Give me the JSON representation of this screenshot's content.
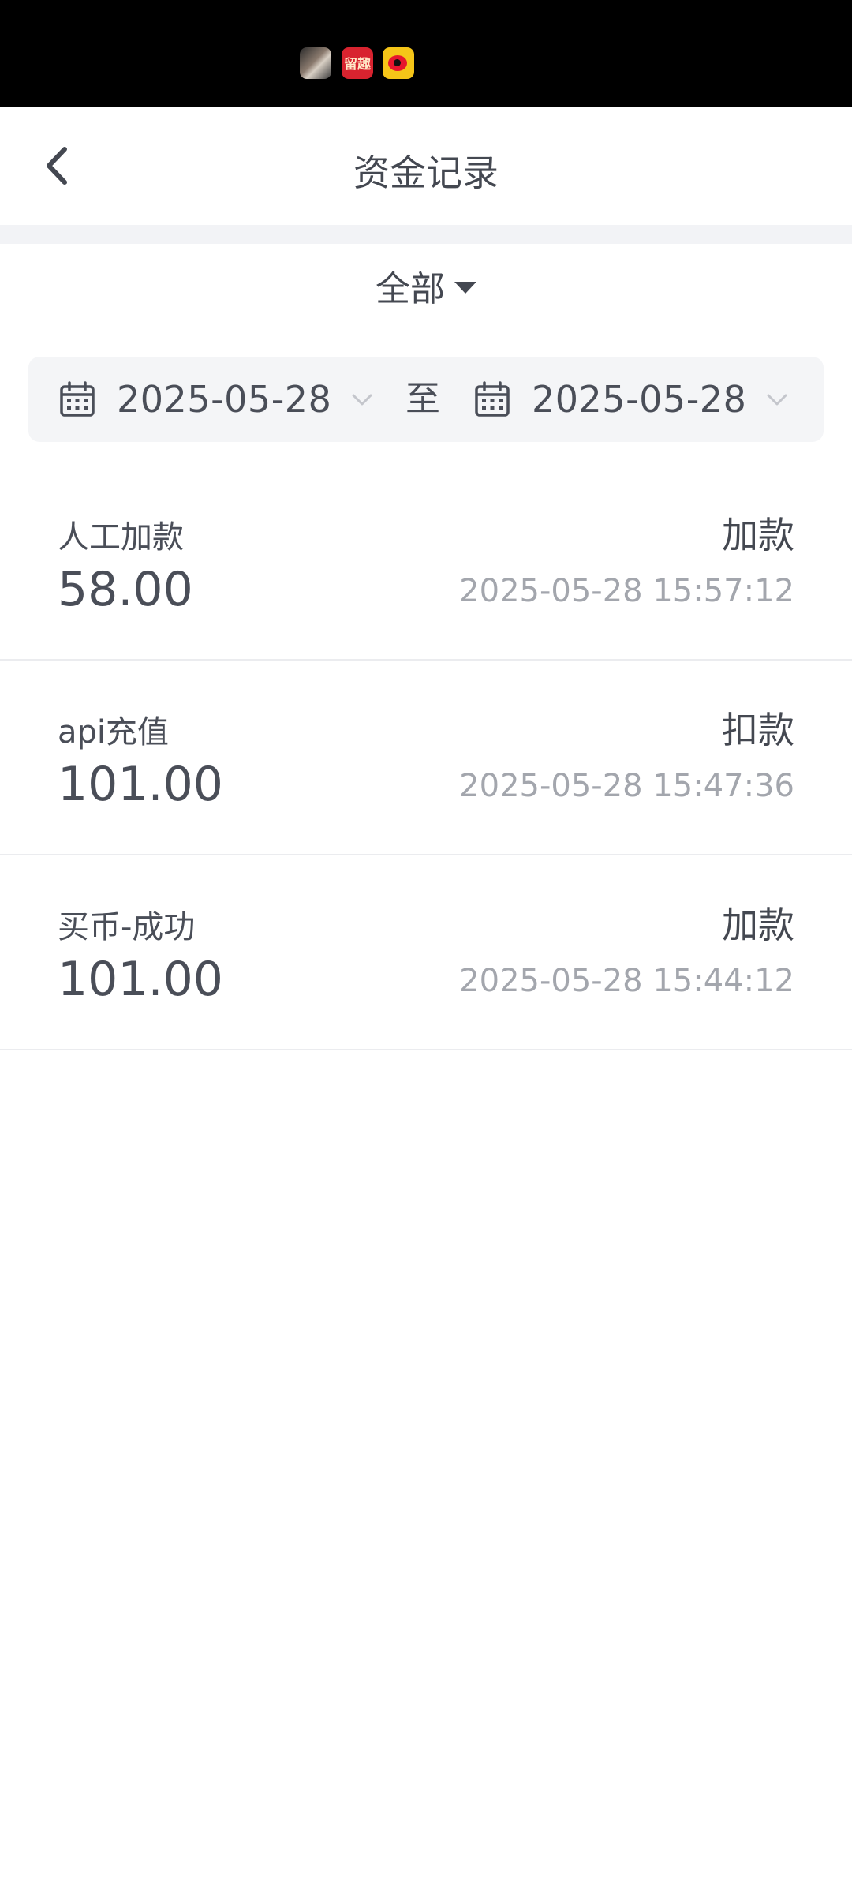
{
  "status_bar": {
    "notification_icons": [
      "photo-app-icon",
      "red-news-app-icon",
      "weibo-icon"
    ],
    "red_icon_text": "留趣"
  },
  "header": {
    "title": "资金记录",
    "back_icon": "chevron-left-icon"
  },
  "filter": {
    "selected": "全部",
    "icon": "caret-down-icon"
  },
  "date_range": {
    "start": "2025-05-28",
    "separator": "至",
    "end": "2025-05-28",
    "calendar_icon": "calendar-icon",
    "dropdown_icon": "chevron-down-icon"
  },
  "records": [
    {
      "title": "人工加款",
      "amount": "58.00",
      "type": "加款",
      "time": "2025-05-28 15:57:12"
    },
    {
      "title": "api充值",
      "amount": "101.00",
      "type": "扣款",
      "time": "2025-05-28 15:47:36"
    },
    {
      "title": "买币-成功",
      "amount": "101.00",
      "type": "加款",
      "time": "2025-05-28 15:44:12"
    }
  ],
  "colors": {
    "status_bar_bg": "#000000",
    "primary_text": "#4a4e58",
    "secondary_text": "#a3a6ad",
    "date_range_bg": "#f4f5f7",
    "divider": "#ebecef"
  }
}
